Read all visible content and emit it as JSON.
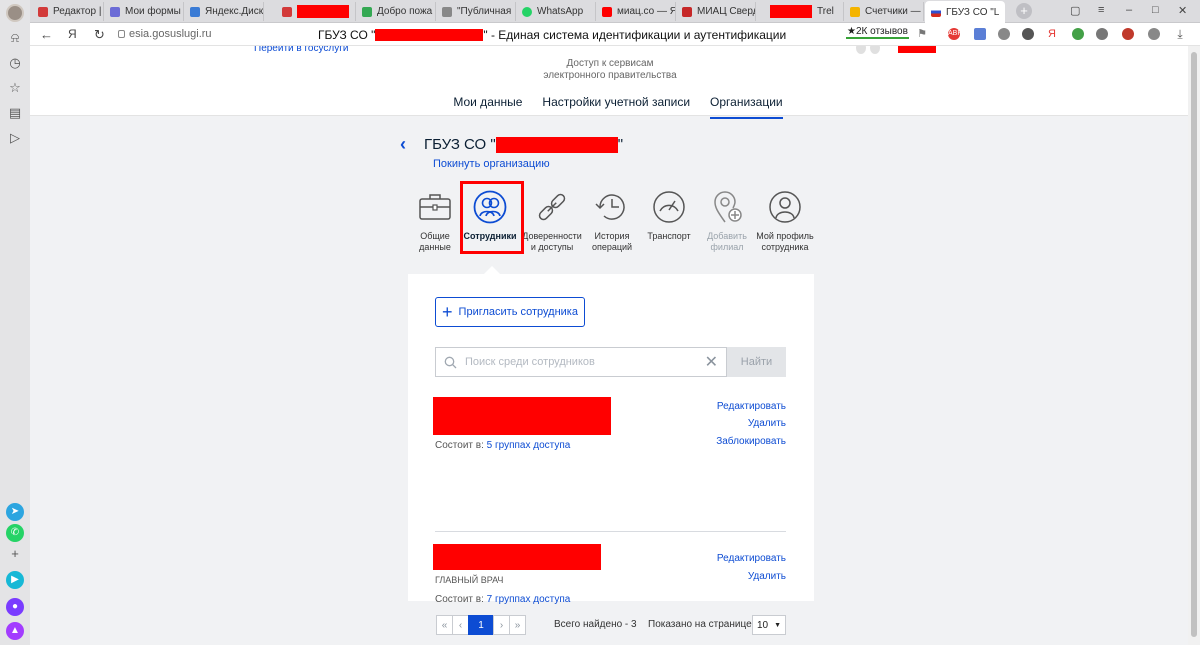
{
  "browser": {
    "tabs": [
      {
        "label": "Редактор | К",
        "color": "#d23a3a"
      },
      {
        "label": "Мои формы",
        "color": "#6b6bd6"
      },
      {
        "label": "Яндекс.Диск",
        "color": "#3a7bd5"
      },
      {
        "label": "",
        "color": "#d23a3a"
      },
      {
        "label": "Добро пожа",
        "color": "#34a853"
      },
      {
        "label": "\"Публичная",
        "color": "#888888"
      },
      {
        "label": "WhatsApp",
        "color": "#25d366"
      },
      {
        "label": "миац.со — Я",
        "color": "#ff0000"
      },
      {
        "label": "МИАЦ Сверд",
        "color": "#c62828"
      },
      {
        "label": "Trel",
        "color": "#0079bf"
      },
      {
        "label": "Счетчики —",
        "color": "#f4b400"
      },
      {
        "label": "ГБУЗ СО \"L",
        "color": "#3050d0"
      }
    ],
    "active_tab_close": "×",
    "new_tab": "+",
    "url": "esia.gosuslugi.ru",
    "page_title_prefix": "ГБУЗ СО \"",
    "page_title_suffix": "\" - Единая система идентификации и аутентификации",
    "reviews": "★2К отзывов",
    "yandex_letter": "Я"
  },
  "header": {
    "back_link": "Перейти в госуслуги",
    "subtitle_line1": "Доступ к сервисам",
    "subtitle_line2": "электронного правительства",
    "nav": [
      "Мои данные",
      "Настройки учетной записи",
      "Организации"
    ]
  },
  "org": {
    "title_prefix": "ГБУЗ СО \"",
    "title_suffix": "\"",
    "leave_link": "Покинуть организацию"
  },
  "categories": [
    {
      "label1": "Общие",
      "label2": "данные",
      "icon": "briefcase-icon"
    },
    {
      "label1": "Сотрудники",
      "label2": "",
      "icon": "users-icon"
    },
    {
      "label1": "Доверенности",
      "label2": "и доступы",
      "icon": "link-icon"
    },
    {
      "label1": "История",
      "label2": "операций",
      "icon": "history-icon"
    },
    {
      "label1": "Транспорт",
      "label2": "",
      "icon": "speedometer-icon"
    },
    {
      "label1": "Добавить",
      "label2": "филиал",
      "icon": "add-location-icon"
    },
    {
      "label1": "Мой профиль",
      "label2": "сотрудника",
      "icon": "profile-icon"
    }
  ],
  "employees": {
    "invite_button": "Пригласить сотрудника",
    "search_placeholder": "Поиск среди сотрудников",
    "find_button": "Найти",
    "list": [
      {
        "role": "",
        "groups_prefix": "Состоит в: ",
        "groups_link": "5 группах доступа",
        "actions": [
          "Редактировать",
          "Удалить",
          "Заблокировать"
        ]
      },
      {
        "role": "ГЛАВНЫЙ ВРАЧ",
        "groups_prefix": "Состоит в: ",
        "groups_link": "7 группах доступа",
        "actions": [
          "Редактировать",
          "Удалить"
        ]
      }
    ]
  },
  "pagination": {
    "first": "«",
    "prev": "‹",
    "current": "1",
    "next": "›",
    "last": "»",
    "total": "Всего найдено - 3",
    "per_page_label": "Показано на странице",
    "per_page_value": "10",
    "per_page_caret": "▼"
  },
  "colors": {
    "accent": "#0d4cd3",
    "redaction": "#ff0000",
    "highlight_box": "#ff0000"
  }
}
